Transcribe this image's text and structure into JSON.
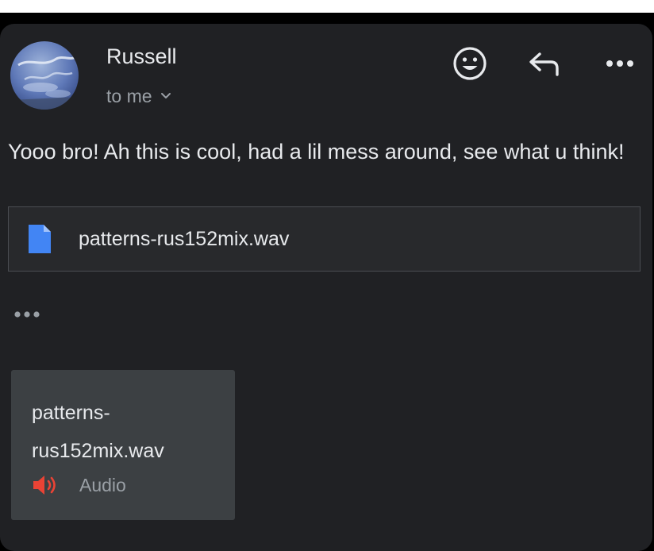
{
  "sender": {
    "name": "Russell",
    "recipient_label": "to me"
  },
  "message": {
    "body": "Yooo bro! Ah this is cool, had a lil mess around, see what u think!"
  },
  "attachment": {
    "filename": "patterns-rus152mix.wav",
    "icon": "document-icon"
  },
  "audio_card": {
    "filename": "patterns-\nrus152mix.wav",
    "type_label": "Audio",
    "icon": "speaker-icon"
  },
  "actions": {
    "emoji_icon": "smiley-icon",
    "reply_icon": "reply-icon",
    "more_icon": "more-options-icon"
  },
  "colors": {
    "background": "#202124",
    "text_primary": "#e8eaed",
    "text_secondary": "#9aa0a6",
    "doc_icon": "#4285f4",
    "audio_icon": "#ea4335",
    "audio_card_bg": "#3c4043"
  }
}
